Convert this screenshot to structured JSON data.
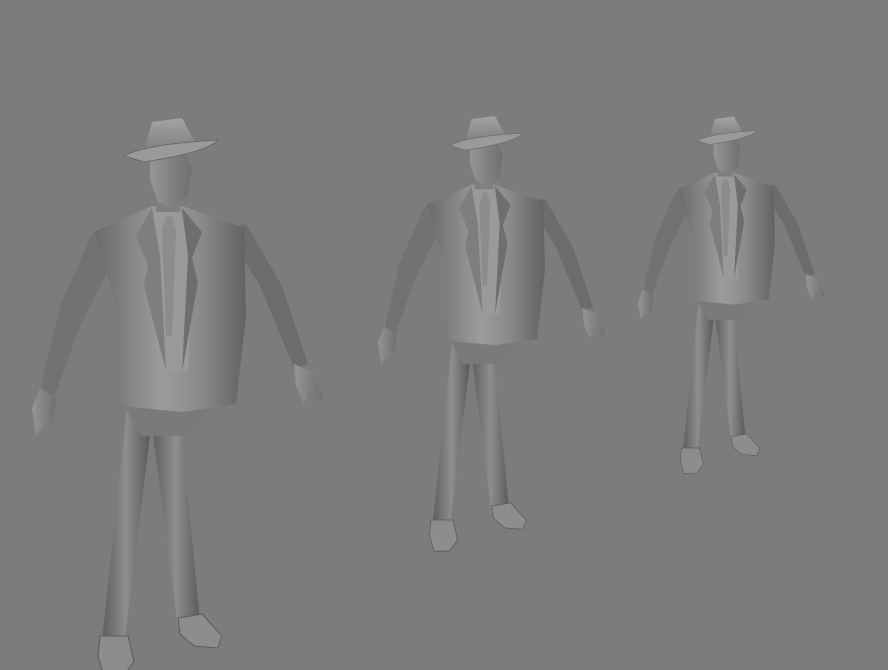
{
  "viewport": {
    "background_color": "#7c7c7c",
    "shading_mode": "smooth-shaded-gray"
  },
  "models": [
    {
      "name": "man-in-suit-and-fedora",
      "lod": "high"
    },
    {
      "name": "man-in-suit-and-fedora",
      "lod": "medium"
    },
    {
      "name": "man-in-suit-and-fedora",
      "lod": "low"
    }
  ],
  "colors": {
    "model_base": "#8a8a8a",
    "model_highlight": "#a8a8a8",
    "model_shadow": "#5a5a5a"
  }
}
